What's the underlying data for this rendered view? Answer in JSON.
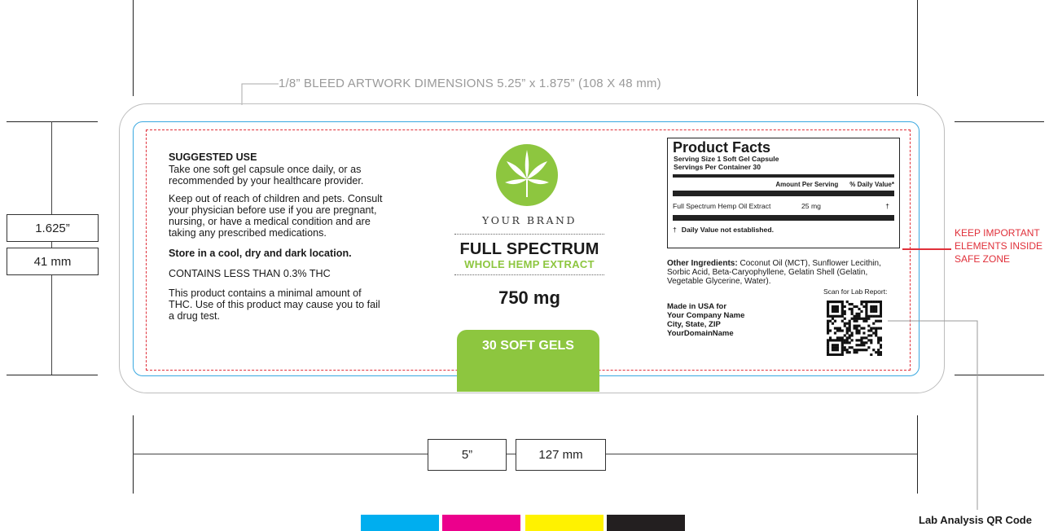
{
  "dims": {
    "bleed_label": "1/8” BLEED ARTWORK DIMENSIONS 5.25” x 1.875” (108 X 48 mm)",
    "height_in": "1.625”",
    "height_mm": "41 mm",
    "width_in": "5”",
    "width_mm": "127 mm"
  },
  "left": {
    "suggested_heading": "SUGGESTED USE",
    "suggested_text": "Take one soft gel capsule once daily, or as recommended by your healthcare provider.",
    "warning_text": "Keep out of reach of children and pets. Consult your physician before use if you are pregnant, nursing, or have a medical condition and are taking any prescribed medications.",
    "storage_text": "Store in a cool, dry and dark location.",
    "thc_text": "CONTAINS LESS THAN 0.3% THC",
    "thc_warning": "This product contains a minimal amount of THC. Use of this product may cause you to fail a drug test."
  },
  "center": {
    "brand": "YOUR BRAND",
    "title_line1": "FULL SPECTRUM",
    "title_line2": "WHOLE HEMP EXTRACT",
    "amount": "750 mg",
    "count": "30 SOFT GELS"
  },
  "facts": {
    "title": "Product Facts",
    "serving_size": "Serving Size 1 Soft Gel Capsule",
    "servings_per_container": "Servings Per Container 30",
    "col_amount": "Amount Per Serving",
    "col_dv": "% Daily Value*",
    "ingredient_name": "Full Spectrum Hemp Oil Extract",
    "ingredient_amount": "25 mg",
    "ingredient_dv": "†",
    "footnote_symbol": "†",
    "footnote": "Daily Value not established."
  },
  "right": {
    "other_label": "Other Ingredients:",
    "other_text": "Coconut Oil (MCT), Sunflower Lecithin, Sorbic Acid, Beta-Caryophyllene, Gelatin Shell (Gelatin, Vegetable Glycerine, Water).",
    "scan_label": "Scan for Lab Report:",
    "made_in": "Made in USA for",
    "company": "Your Company Name",
    "city": "City, State, ZIP",
    "domain": "YourDomainName"
  },
  "annotations": {
    "safe_zone": "KEEP IMPORTANT ELEMENTS INSIDE SAFE ZONE",
    "qr_caption": "Lab Analysis QR Code"
  },
  "colors": {
    "green": "#8dc63f",
    "trim_blue": "#3aa8e0",
    "safe_red": "#e0303a",
    "cyan": "#00aeef",
    "magenta": "#ec008c",
    "yellow": "#fff200",
    "black": "#231f20"
  }
}
